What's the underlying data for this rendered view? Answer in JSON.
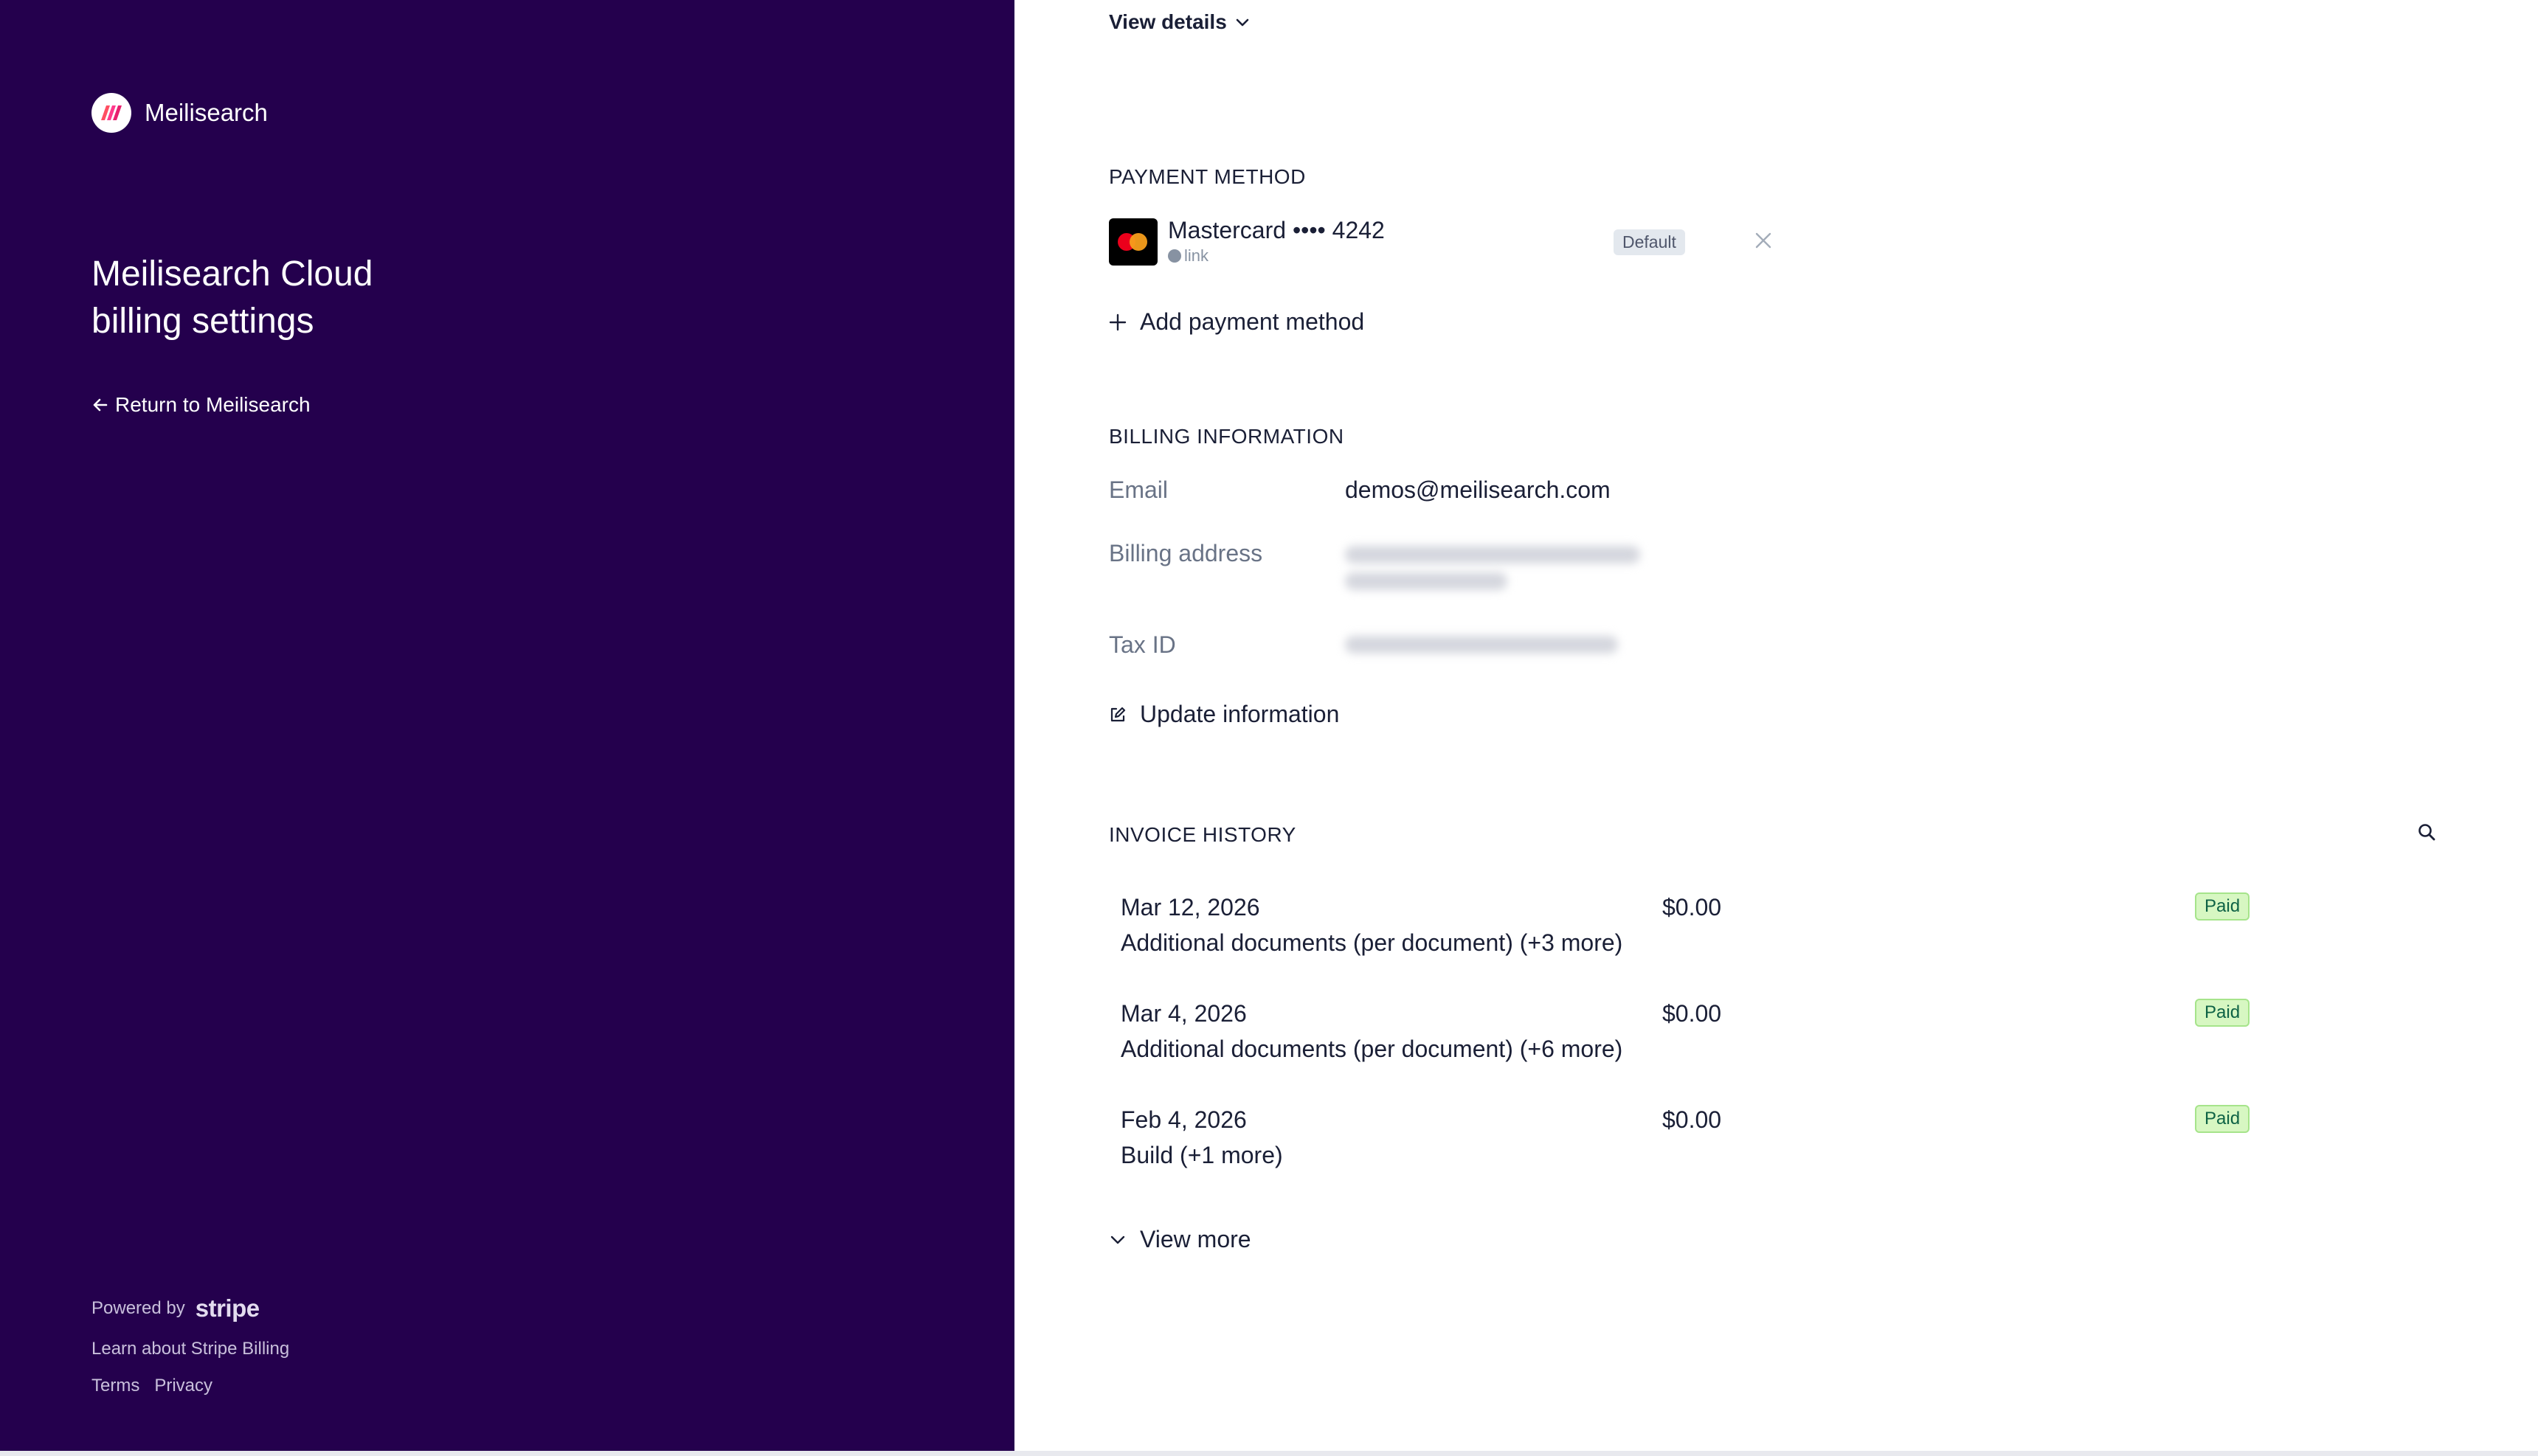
{
  "brand": {
    "name": "Meilisearch"
  },
  "sidebar": {
    "title_line1": "Meilisearch Cloud",
    "title_line2": "billing settings",
    "return_label": "Return to Meilisearch"
  },
  "footer": {
    "powered_by": "Powered by",
    "stripe": "stripe",
    "learn": "Learn about Stripe Billing",
    "terms": "Terms",
    "privacy": "Privacy"
  },
  "subscription": {
    "view_details": "View details"
  },
  "payment": {
    "title": "PAYMENT METHOD",
    "card_label": "Mastercard •••• 4242",
    "card_sub": "link",
    "default_badge": "Default",
    "add_label": "Add payment method"
  },
  "billing": {
    "title": "BILLING INFORMATION",
    "email_label": "Email",
    "email_value": "demos@meilisearch.com",
    "address_label": "Billing address",
    "tax_label": "Tax ID",
    "update_label": "Update information"
  },
  "invoices": {
    "title": "INVOICE HISTORY",
    "rows": [
      {
        "date": "Mar 12, 2026",
        "amount": "$0.00",
        "desc": "Additional documents (per document) (+3 more)",
        "status": "Paid"
      },
      {
        "date": "Mar 4, 2026",
        "amount": "$0.00",
        "desc": "Additional documents (per document) (+6 more)",
        "status": "Paid"
      },
      {
        "date": "Feb 4, 2026",
        "amount": "$0.00",
        "desc": "Build (+1 more)",
        "status": "Paid"
      }
    ],
    "view_more": "View more"
  },
  "colors": {
    "sidebar_bg": "#24004d",
    "paid_bg": "#d7f7c2",
    "paid_text": "#0e6245"
  }
}
